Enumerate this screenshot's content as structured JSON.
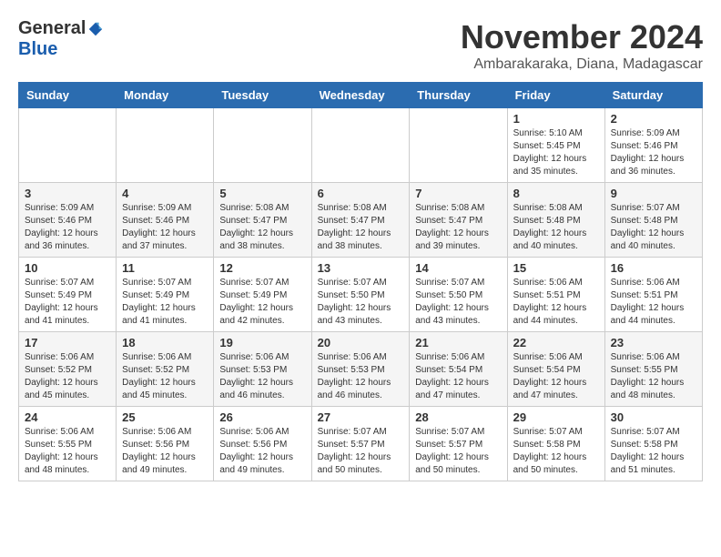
{
  "header": {
    "logo_general": "General",
    "logo_blue": "Blue",
    "month_title": "November 2024",
    "location": "Ambarakaraka, Diana, Madagascar"
  },
  "days_of_week": [
    "Sunday",
    "Monday",
    "Tuesday",
    "Wednesday",
    "Thursday",
    "Friday",
    "Saturday"
  ],
  "weeks": [
    [
      {
        "day": "",
        "info": ""
      },
      {
        "day": "",
        "info": ""
      },
      {
        "day": "",
        "info": ""
      },
      {
        "day": "",
        "info": ""
      },
      {
        "day": "",
        "info": ""
      },
      {
        "day": "1",
        "info": "Sunrise: 5:10 AM\nSunset: 5:45 PM\nDaylight: 12 hours and 35 minutes."
      },
      {
        "day": "2",
        "info": "Sunrise: 5:09 AM\nSunset: 5:46 PM\nDaylight: 12 hours and 36 minutes."
      }
    ],
    [
      {
        "day": "3",
        "info": "Sunrise: 5:09 AM\nSunset: 5:46 PM\nDaylight: 12 hours and 36 minutes."
      },
      {
        "day": "4",
        "info": "Sunrise: 5:09 AM\nSunset: 5:46 PM\nDaylight: 12 hours and 37 minutes."
      },
      {
        "day": "5",
        "info": "Sunrise: 5:08 AM\nSunset: 5:47 PM\nDaylight: 12 hours and 38 minutes."
      },
      {
        "day": "6",
        "info": "Sunrise: 5:08 AM\nSunset: 5:47 PM\nDaylight: 12 hours and 38 minutes."
      },
      {
        "day": "7",
        "info": "Sunrise: 5:08 AM\nSunset: 5:47 PM\nDaylight: 12 hours and 39 minutes."
      },
      {
        "day": "8",
        "info": "Sunrise: 5:08 AM\nSunset: 5:48 PM\nDaylight: 12 hours and 40 minutes."
      },
      {
        "day": "9",
        "info": "Sunrise: 5:07 AM\nSunset: 5:48 PM\nDaylight: 12 hours and 40 minutes."
      }
    ],
    [
      {
        "day": "10",
        "info": "Sunrise: 5:07 AM\nSunset: 5:49 PM\nDaylight: 12 hours and 41 minutes."
      },
      {
        "day": "11",
        "info": "Sunrise: 5:07 AM\nSunset: 5:49 PM\nDaylight: 12 hours and 41 minutes."
      },
      {
        "day": "12",
        "info": "Sunrise: 5:07 AM\nSunset: 5:49 PM\nDaylight: 12 hours and 42 minutes."
      },
      {
        "day": "13",
        "info": "Sunrise: 5:07 AM\nSunset: 5:50 PM\nDaylight: 12 hours and 43 minutes."
      },
      {
        "day": "14",
        "info": "Sunrise: 5:07 AM\nSunset: 5:50 PM\nDaylight: 12 hours and 43 minutes."
      },
      {
        "day": "15",
        "info": "Sunrise: 5:06 AM\nSunset: 5:51 PM\nDaylight: 12 hours and 44 minutes."
      },
      {
        "day": "16",
        "info": "Sunrise: 5:06 AM\nSunset: 5:51 PM\nDaylight: 12 hours and 44 minutes."
      }
    ],
    [
      {
        "day": "17",
        "info": "Sunrise: 5:06 AM\nSunset: 5:52 PM\nDaylight: 12 hours and 45 minutes."
      },
      {
        "day": "18",
        "info": "Sunrise: 5:06 AM\nSunset: 5:52 PM\nDaylight: 12 hours and 45 minutes."
      },
      {
        "day": "19",
        "info": "Sunrise: 5:06 AM\nSunset: 5:53 PM\nDaylight: 12 hours and 46 minutes."
      },
      {
        "day": "20",
        "info": "Sunrise: 5:06 AM\nSunset: 5:53 PM\nDaylight: 12 hours and 46 minutes."
      },
      {
        "day": "21",
        "info": "Sunrise: 5:06 AM\nSunset: 5:54 PM\nDaylight: 12 hours and 47 minutes."
      },
      {
        "day": "22",
        "info": "Sunrise: 5:06 AM\nSunset: 5:54 PM\nDaylight: 12 hours and 47 minutes."
      },
      {
        "day": "23",
        "info": "Sunrise: 5:06 AM\nSunset: 5:55 PM\nDaylight: 12 hours and 48 minutes."
      }
    ],
    [
      {
        "day": "24",
        "info": "Sunrise: 5:06 AM\nSunset: 5:55 PM\nDaylight: 12 hours and 48 minutes."
      },
      {
        "day": "25",
        "info": "Sunrise: 5:06 AM\nSunset: 5:56 PM\nDaylight: 12 hours and 49 minutes."
      },
      {
        "day": "26",
        "info": "Sunrise: 5:06 AM\nSunset: 5:56 PM\nDaylight: 12 hours and 49 minutes."
      },
      {
        "day": "27",
        "info": "Sunrise: 5:07 AM\nSunset: 5:57 PM\nDaylight: 12 hours and 50 minutes."
      },
      {
        "day": "28",
        "info": "Sunrise: 5:07 AM\nSunset: 5:57 PM\nDaylight: 12 hours and 50 minutes."
      },
      {
        "day": "29",
        "info": "Sunrise: 5:07 AM\nSunset: 5:58 PM\nDaylight: 12 hours and 50 minutes."
      },
      {
        "day": "30",
        "info": "Sunrise: 5:07 AM\nSunset: 5:58 PM\nDaylight: 12 hours and 51 minutes."
      }
    ]
  ]
}
